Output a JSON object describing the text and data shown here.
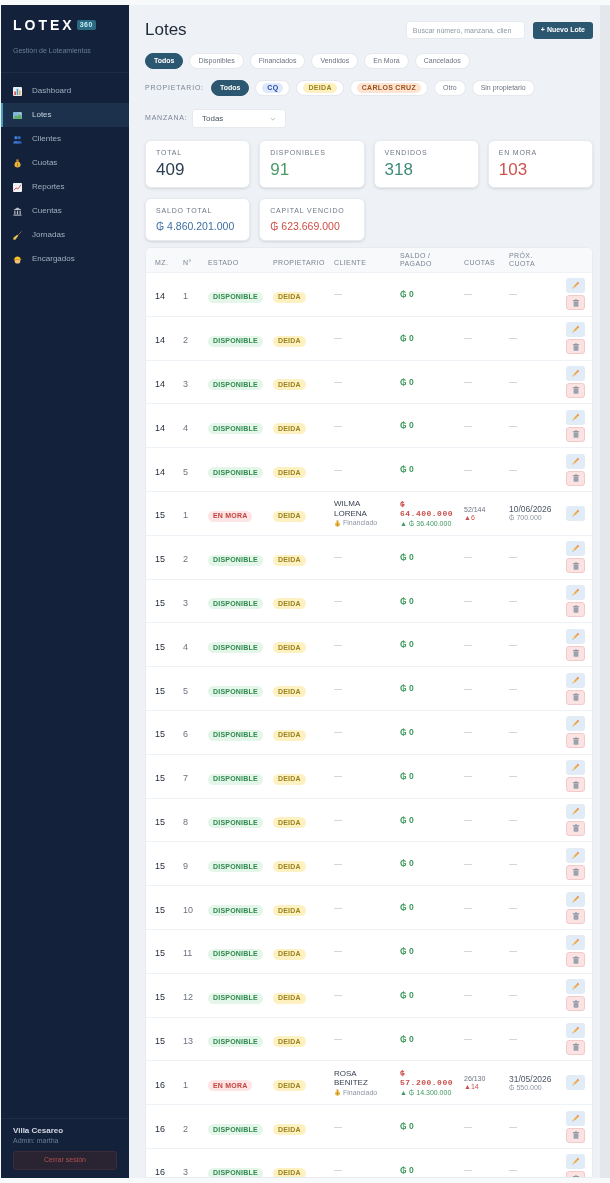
{
  "sidebar": {
    "logo": "LOTEX",
    "logo_badge": "360",
    "subtitle": "Gestión de Loteamientos",
    "items": [
      {
        "label": "Dashboard",
        "selected": false
      },
      {
        "label": "Lotes",
        "selected": true
      },
      {
        "label": "Clientes",
        "selected": false
      },
      {
        "label": "Cuotas",
        "selected": false
      },
      {
        "label": "Reportes",
        "selected": false
      },
      {
        "label": "Cuentas",
        "selected": false
      },
      {
        "label": "Jornadas",
        "selected": false
      },
      {
        "label": "Encargados",
        "selected": false
      }
    ],
    "footer": {
      "name": "Villa Cesareo",
      "role": "Admin: martha",
      "logout_button": "Cerrar sesión"
    }
  },
  "header": {
    "title": "Lotes",
    "search": {
      "placeholder": "Buscar número, manzana, clien"
    },
    "new_button": "+ Nuevo Lote"
  },
  "status_filters": [
    {
      "label": "Todos",
      "selected": true
    },
    {
      "label": "Disponibles",
      "selected": false
    },
    {
      "label": "Financiados",
      "selected": false
    },
    {
      "label": "Vendidos",
      "selected": false
    },
    {
      "label": "En Mora",
      "selected": false
    },
    {
      "label": "Cancelados",
      "selected": false
    }
  ],
  "owner_filter": {
    "label": "PROPIETARIO:",
    "options": [
      {
        "label": "Todos",
        "selected": true
      },
      {
        "label": "CQ",
        "selected": false,
        "color": "#dfe9fb"
      },
      {
        "label": "DEIDA",
        "selected": false,
        "color": "#fdf1c2"
      },
      {
        "label": "CARLOS CRUZ",
        "selected": false,
        "color": "#fde4d2"
      },
      {
        "label": "Otro",
        "selected": false
      },
      {
        "label": "Sin propietario",
        "selected": false
      }
    ]
  },
  "block_filter": {
    "label": "MANZANA:",
    "value": "Todas"
  },
  "stats": [
    {
      "label": "TOTAL",
      "value": "409",
      "kind": "count",
      "color": "#2d3f52"
    },
    {
      "label": "DISPONIBLES",
      "value": "91",
      "kind": "count",
      "color": "#4d9a68"
    },
    {
      "label": "VENDIDOS",
      "value": "318",
      "kind": "count",
      "color": "#3f8b7a"
    },
    {
      "label": "EN MORA",
      "value": "103",
      "kind": "count",
      "color": "#c9534f"
    },
    {
      "label": "SALDO TOTAL",
      "value": "₲ 4.860.201.000",
      "kind": "amount",
      "color": "#3e6fa3"
    },
    {
      "label": "CAPITAL VENCIDO",
      "value": "₲ 623.669.000",
      "kind": "amount",
      "color": "#cf4f45"
    }
  ],
  "table": {
    "columns": [
      "MZ.",
      "N°",
      "ESTADO",
      "PROPIETARIO",
      "CLIENTE",
      "SALDO / PAGADO",
      "CUOTAS",
      "PRÓX. CUOTA"
    ],
    "rows": [
      {
        "block": "14",
        "number": "1",
        "status": {
          "label": "DISPONIBLE",
          "kind": "available"
        },
        "owner": {
          "label": "DEIDA",
          "color": "#fdf1c2"
        },
        "client": {
          "name": "—"
        },
        "balance": "₲ 0",
        "installments": "—",
        "next_due": "—",
        "can_delete": true
      },
      {
        "block": "14",
        "number": "2",
        "status": {
          "label": "DISPONIBLE",
          "kind": "available"
        },
        "owner": {
          "label": "DEIDA",
          "color": "#fdf1c2"
        },
        "client": {
          "name": "—"
        },
        "balance": "₲ 0",
        "installments": "—",
        "next_due": "—",
        "can_delete": true
      },
      {
        "block": "14",
        "number": "3",
        "status": {
          "label": "DISPONIBLE",
          "kind": "available"
        },
        "owner": {
          "label": "DEIDA",
          "color": "#fdf1c2"
        },
        "client": {
          "name": "—"
        },
        "balance": "₲ 0",
        "installments": "—",
        "next_due": "—",
        "can_delete": true
      },
      {
        "block": "14",
        "number": "4",
        "status": {
          "label": "DISPONIBLE",
          "kind": "available"
        },
        "owner": {
          "label": "DEIDA",
          "color": "#fdf1c2"
        },
        "client": {
          "name": "—"
        },
        "balance": "₲ 0",
        "installments": "—",
        "next_due": "—",
        "can_delete": true
      },
      {
        "block": "14",
        "number": "5",
        "status": {
          "label": "DISPONIBLE",
          "kind": "available"
        },
        "owner": {
          "label": "DEIDA",
          "color": "#fdf1c2"
        },
        "client": {
          "name": "—"
        },
        "balance": "₲ 0",
        "installments": "—",
        "next_due": "—",
        "can_delete": true
      },
      {
        "block": "15",
        "number": "1",
        "status": {
          "label": "EN MORA",
          "kind": "overdue"
        },
        "owner": {
          "label": "DEIDA",
          "color": "#fdf1c2"
        },
        "client": {
          "name": "WILMA LORENA",
          "plan": "Financiado"
        },
        "balance": "₲ 64.400.000",
        "paid": "▲ ₲ 36.400.000",
        "installments": "52/144",
        "overdue_installments": "▲6",
        "next_due": "10/06/2026",
        "next_amount": "₲ 700.000",
        "can_delete": false
      },
      {
        "block": "15",
        "number": "2",
        "status": {
          "label": "DISPONIBLE",
          "kind": "available"
        },
        "owner": {
          "label": "DEIDA",
          "color": "#fdf1c2"
        },
        "client": {
          "name": "—"
        },
        "balance": "₲ 0",
        "installments": "—",
        "next_due": "—",
        "can_delete": true
      },
      {
        "block": "15",
        "number": "3",
        "status": {
          "label": "DISPONIBLE",
          "kind": "available"
        },
        "owner": {
          "label": "DEIDA",
          "color": "#fdf1c2"
        },
        "client": {
          "name": "—"
        },
        "balance": "₲ 0",
        "installments": "—",
        "next_due": "—",
        "can_delete": true
      },
      {
        "block": "15",
        "number": "4",
        "status": {
          "label": "DISPONIBLE",
          "kind": "available"
        },
        "owner": {
          "label": "DEIDA",
          "color": "#fdf1c2"
        },
        "client": {
          "name": "—"
        },
        "balance": "₲ 0",
        "installments": "—",
        "next_due": "—",
        "can_delete": true
      },
      {
        "block": "15",
        "number": "5",
        "status": {
          "label": "DISPONIBLE",
          "kind": "available"
        },
        "owner": {
          "label": "DEIDA",
          "color": "#fdf1c2"
        },
        "client": {
          "name": "—"
        },
        "balance": "₲ 0",
        "installments": "—",
        "next_due": "—",
        "can_delete": true
      },
      {
        "block": "15",
        "number": "6",
        "status": {
          "label": "DISPONIBLE",
          "kind": "available"
        },
        "owner": {
          "label": "DEIDA",
          "color": "#fdf1c2"
        },
        "client": {
          "name": "—"
        },
        "balance": "₲ 0",
        "installments": "—",
        "next_due": "—",
        "can_delete": true
      },
      {
        "block": "15",
        "number": "7",
        "status": {
          "label": "DISPONIBLE",
          "kind": "available"
        },
        "owner": {
          "label": "DEIDA",
          "color": "#fdf1c2"
        },
        "client": {
          "name": "—"
        },
        "balance": "₲ 0",
        "installments": "—",
        "next_due": "—",
        "can_delete": true
      },
      {
        "block": "15",
        "number": "8",
        "status": {
          "label": "DISPONIBLE",
          "kind": "available"
        },
        "owner": {
          "label": "DEIDA",
          "color": "#fdf1c2"
        },
        "client": {
          "name": "—"
        },
        "balance": "₲ 0",
        "installments": "—",
        "next_due": "—",
        "can_delete": true
      },
      {
        "block": "15",
        "number": "9",
        "status": {
          "label": "DISPONIBLE",
          "kind": "available"
        },
        "owner": {
          "label": "DEIDA",
          "color": "#fdf1c2"
        },
        "client": {
          "name": "—"
        },
        "balance": "₲ 0",
        "installments": "—",
        "next_due": "—",
        "can_delete": true
      },
      {
        "block": "15",
        "number": "10",
        "status": {
          "label": "DISPONIBLE",
          "kind": "available"
        },
        "owner": {
          "label": "DEIDA",
          "color": "#fdf1c2"
        },
        "client": {
          "name": "—"
        },
        "balance": "₲ 0",
        "installments": "—",
        "next_due": "—",
        "can_delete": true
      },
      {
        "block": "15",
        "number": "11",
        "status": {
          "label": "DISPONIBLE",
          "kind": "available"
        },
        "owner": {
          "label": "DEIDA",
          "color": "#fdf1c2"
        },
        "client": {
          "name": "—"
        },
        "balance": "₲ 0",
        "installments": "—",
        "next_due": "—",
        "can_delete": true
      },
      {
        "block": "15",
        "number": "12",
        "status": {
          "label": "DISPONIBLE",
          "kind": "available"
        },
        "owner": {
          "label": "DEIDA",
          "color": "#fdf1c2"
        },
        "client": {
          "name": "—"
        },
        "balance": "₲ 0",
        "installments": "—",
        "next_due": "—",
        "can_delete": true
      },
      {
        "block": "15",
        "number": "13",
        "status": {
          "label": "DISPONIBLE",
          "kind": "available"
        },
        "owner": {
          "label": "DEIDA",
          "color": "#fdf1c2"
        },
        "client": {
          "name": "—"
        },
        "balance": "₲ 0",
        "installments": "—",
        "next_due": "—",
        "can_delete": true
      },
      {
        "block": "16",
        "number": "1",
        "status": {
          "label": "EN MORA",
          "kind": "overdue"
        },
        "owner": {
          "label": "DEIDA",
          "color": "#fdf1c2"
        },
        "client": {
          "name": "ROSA BENITEZ",
          "plan": "Financiado"
        },
        "balance": "₲ 57.200.000",
        "paid": "▲ ₲ 14.300.000",
        "installments": "26/130",
        "overdue_installments": "▲14",
        "next_due": "31/05/2026",
        "next_amount": "₲ 550.000",
        "can_delete": false
      },
      {
        "block": "16",
        "number": "2",
        "status": {
          "label": "DISPONIBLE",
          "kind": "available"
        },
        "owner": {
          "label": "DEIDA",
          "color": "#fdf1c2"
        },
        "client": {
          "name": "—"
        },
        "balance": "₲ 0",
        "installments": "—",
        "next_due": "—",
        "can_delete": true
      },
      {
        "block": "16",
        "number": "3",
        "status": {
          "label": "DISPONIBLE",
          "kind": "available"
        },
        "owner": {
          "label": "DEIDA",
          "color": "#fdf1c2"
        },
        "client": {
          "name": "—"
        },
        "balance": "₲ 0",
        "installments": "—",
        "next_due": "—",
        "can_delete": true
      }
    ]
  }
}
